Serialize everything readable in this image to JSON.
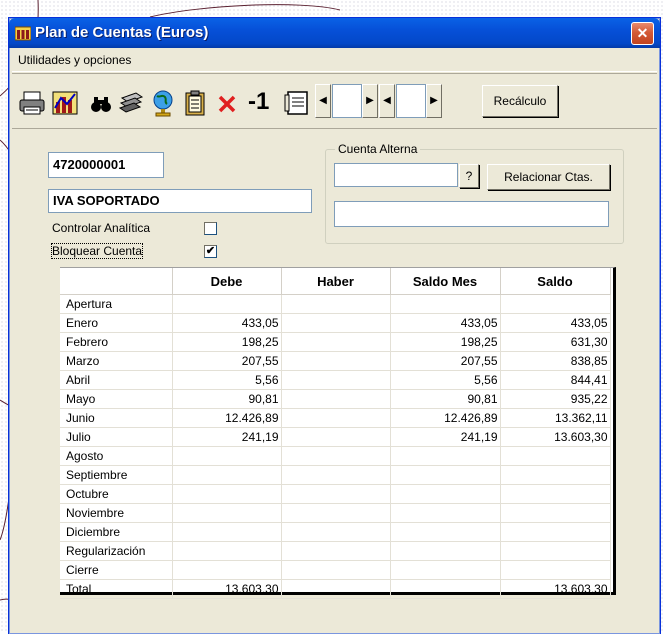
{
  "window": {
    "title": "Plan de Cuentas (Euros)"
  },
  "menu": {
    "label": "Utilidades y opciones"
  },
  "toolbar": {
    "minus_one": "-1",
    "recalc": "Recálculo"
  },
  "account": {
    "code": "4720000001",
    "name": "IVA SOPORTADO"
  },
  "options": {
    "controlar_label": "Controlar Analítica",
    "controlar_checked": false,
    "bloquear_label": "Bloquear Cuenta",
    "bloquear_checked": true
  },
  "alt": {
    "group_label": "Cuenta Alterna",
    "help": "?",
    "relacionar": "Relacionar Ctas."
  },
  "table": {
    "headers": [
      "",
      "Debe",
      "Haber",
      "Saldo Mes",
      "Saldo"
    ],
    "rows": [
      [
        "Apertura",
        "",
        "",
        "",
        ""
      ],
      [
        "Enero",
        "433,05",
        "",
        "433,05",
        "433,05"
      ],
      [
        "Febrero",
        "198,25",
        "",
        "198,25",
        "631,30"
      ],
      [
        "Marzo",
        "207,55",
        "",
        "207,55",
        "838,85"
      ],
      [
        "Abril",
        "5,56",
        "",
        "5,56",
        "844,41"
      ],
      [
        "Mayo",
        "90,81",
        "",
        "90,81",
        "935,22"
      ],
      [
        "Junio",
        "12.426,89",
        "",
        "12.426,89",
        "13.362,11"
      ],
      [
        "Julio",
        "241,19",
        "",
        "241,19",
        "13.603,30"
      ],
      [
        "Agosto",
        "",
        "",
        "",
        ""
      ],
      [
        "Septiembre",
        "",
        "",
        "",
        ""
      ],
      [
        "Octubre",
        "",
        "",
        "",
        ""
      ],
      [
        "Noviembre",
        "",
        "",
        "",
        ""
      ],
      [
        "Diciembre",
        "",
        "",
        "",
        ""
      ],
      [
        "Regularización",
        "",
        "",
        "",
        ""
      ],
      [
        "Cierre",
        "",
        "",
        "",
        ""
      ],
      [
        "Total",
        "13.603,30",
        "",
        "",
        "13.603,30"
      ]
    ]
  },
  "colors": {
    "titlebar": "#0348c8",
    "window_bg": "#ece9d8",
    "close": "#d45a36"
  },
  "icons": [
    "printer-icon",
    "chart-icon",
    "binoculars-icon",
    "stack-icon",
    "globe-icon",
    "clipboard-icon",
    "delete-icon",
    "ledger-icon"
  ]
}
